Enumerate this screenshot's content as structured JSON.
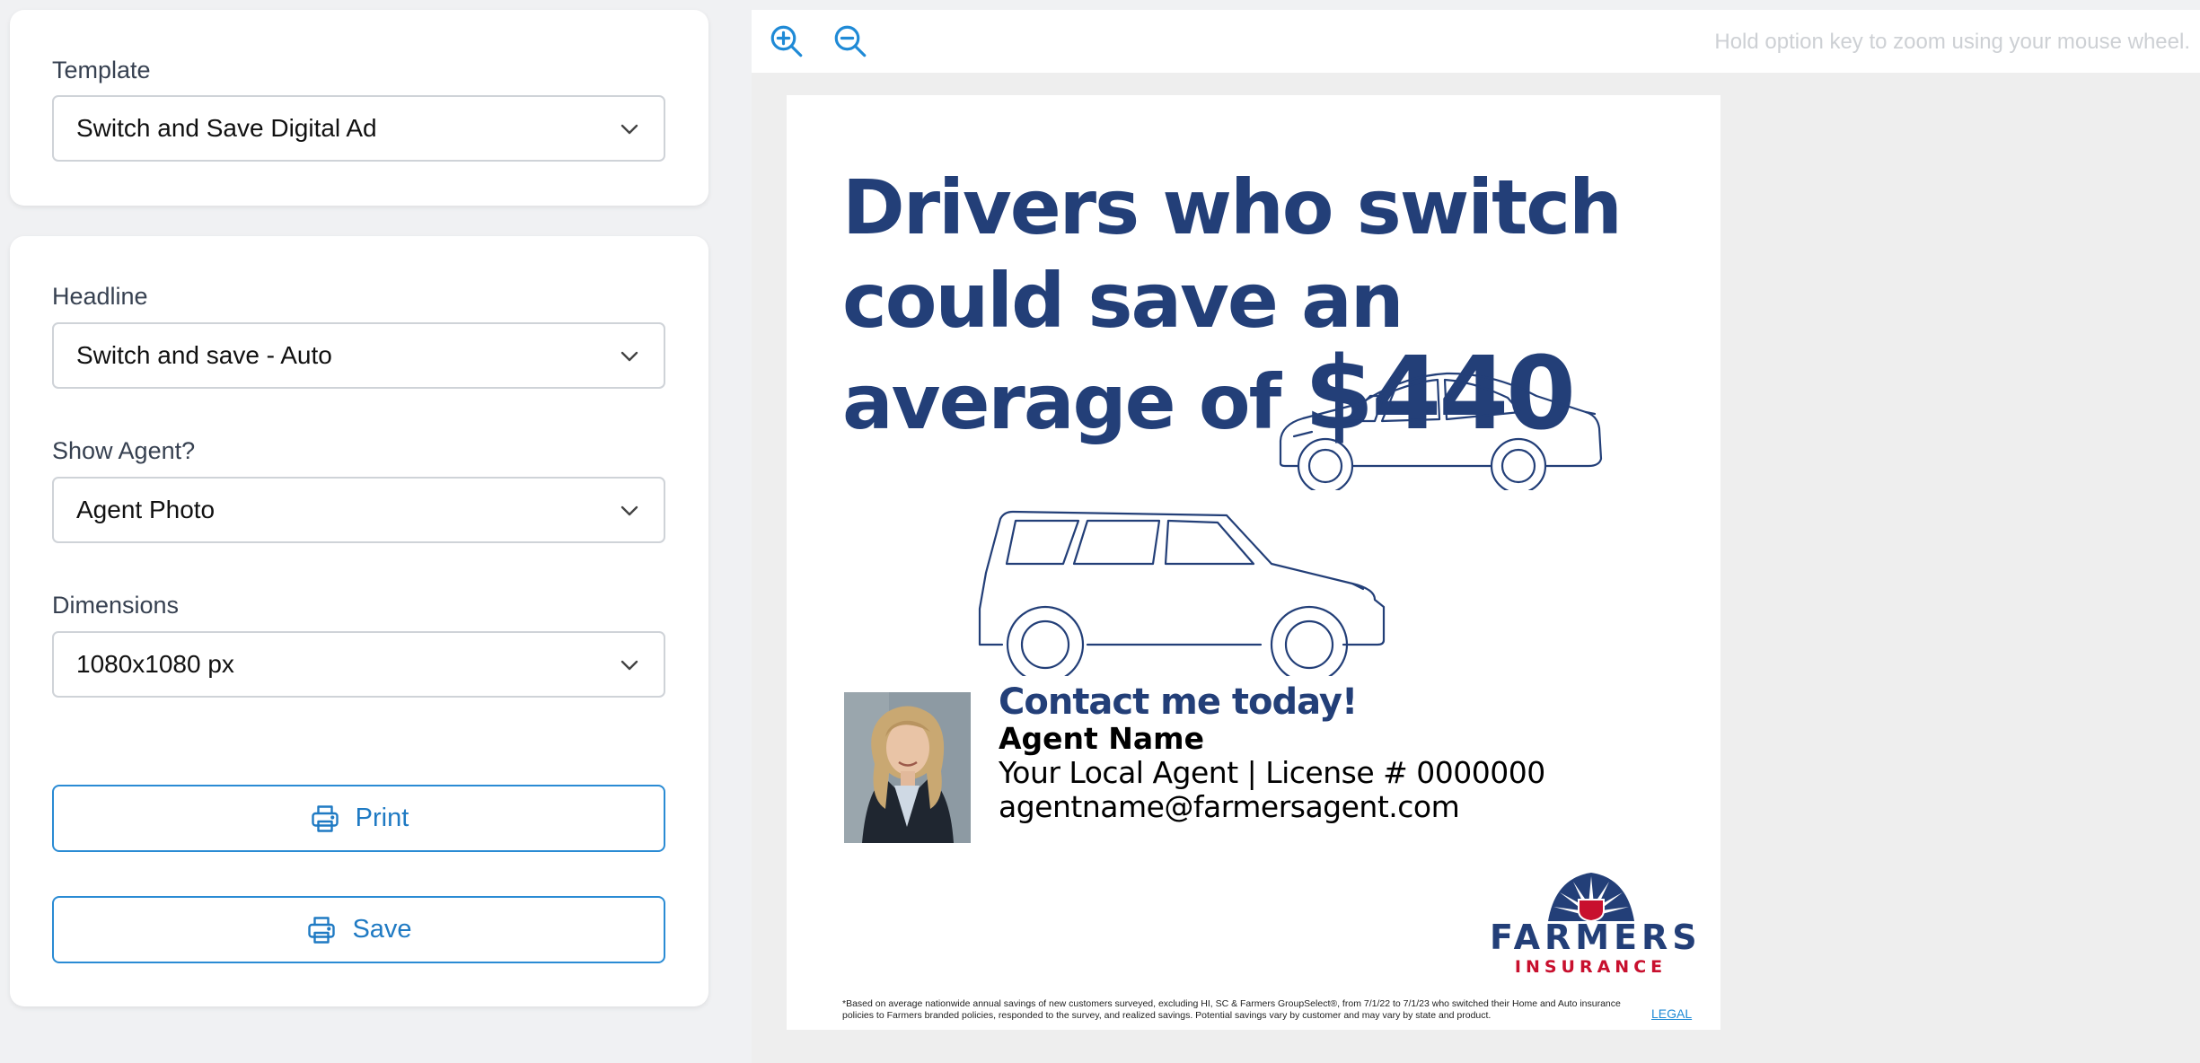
{
  "template": {
    "label": "Template",
    "selected": "Switch and Save Digital Ad"
  },
  "options": {
    "headline": {
      "label": "Headline",
      "selected": "Switch and save - Auto"
    },
    "show_agent": {
      "label": "Show Agent?",
      "selected": "Agent Photo"
    },
    "dimensions": {
      "label": "Dimensions",
      "selected": "1080x1080 px"
    }
  },
  "actions": {
    "print_label": "Print",
    "save_label": "Save"
  },
  "toolbar": {
    "zoom_hint": "Hold option key to zoom using your mouse wheel.",
    "zoom_in_icon": "zoom-in-icon",
    "zoom_out_icon": "zoom-out-icon"
  },
  "ad": {
    "headline_part1": "Drivers who switch could save an average of ",
    "headline_amount": "$440",
    "contact_title": "Contact me today!",
    "agent_name": "Agent Name",
    "agent_title": "Your Local Agent | License # 0000000",
    "agent_email": "agentname@farmersagent.com",
    "logo_word1": "FARMERS",
    "logo_word2": "INSURANCE",
    "disclaimer": "*Based on average nationwide annual savings of new customers surveyed, excluding HI, SC & Farmers GroupSelect®, from 7/1/22 to 7/1/23 who switched their Home and Auto insurance policies to Farmers branded policies, responded to the survey, and realized savings. Potential savings vary by customer and may vary by state and product.",
    "legal_link": "LEGAL"
  },
  "colors": {
    "brand_navy": "#233f78",
    "brand_red": "#c8102e",
    "accent_blue": "#2a8bd4"
  }
}
